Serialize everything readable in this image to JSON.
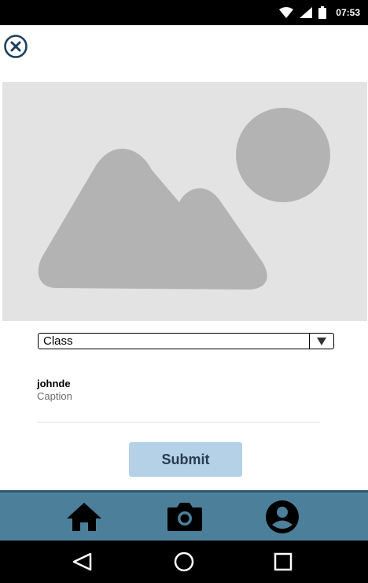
{
  "status_bar": {
    "time": "07:53",
    "icons": [
      "wifi-icon",
      "signal-icon",
      "battery-icon"
    ]
  },
  "header": {
    "close_icon": "close-icon"
  },
  "image_placeholder": {
    "icon": "image-placeholder-icon"
  },
  "class_select": {
    "selected": "Class",
    "arrow_icon": "dropdown-arrow-icon"
  },
  "post": {
    "username": "johnde",
    "caption": "Caption"
  },
  "submit": {
    "label": "Submit"
  },
  "tab_bar": {
    "items": [
      {
        "name": "home",
        "icon": "home-icon"
      },
      {
        "name": "camera",
        "icon": "camera-icon"
      },
      {
        "name": "profile",
        "icon": "account-icon"
      }
    ]
  },
  "nav_bar": {
    "icons": [
      "back-icon",
      "home-circle-icon",
      "recents-icon"
    ]
  },
  "colors": {
    "tab_bar": "#4c7f9a",
    "submit_button": "#b4d1e8",
    "placeholder_bg": "#e3e3e3",
    "placeholder_shape": "#b3b3b3",
    "close_icon": "#1f3f5e"
  }
}
